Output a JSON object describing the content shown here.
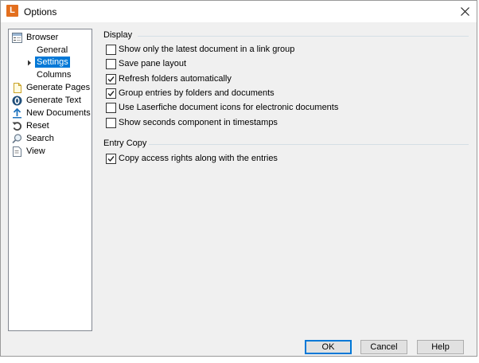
{
  "window": {
    "title": "Options",
    "app_icon_letter": "L",
    "app_icon_color": "#e36f1e"
  },
  "tree": {
    "items": [
      {
        "label": "Browser",
        "icon": "browser-icon",
        "level": 0
      },
      {
        "label": "General",
        "icon": "",
        "level": 1
      },
      {
        "label": "Settings",
        "icon": "",
        "level": 1,
        "selected": true,
        "expander": "collapsed"
      },
      {
        "label": "Columns",
        "icon": "",
        "level": 1
      },
      {
        "label": "Generate Pages",
        "icon": "generate-pages-icon",
        "level": 0
      },
      {
        "label": "Generate Text",
        "icon": "generate-text-icon",
        "level": 0
      },
      {
        "label": "New Documents",
        "icon": "new-documents-icon",
        "level": 0
      },
      {
        "label": "Reset",
        "icon": "reset-icon",
        "level": 0
      },
      {
        "label": "Search",
        "icon": "search-icon",
        "level": 0
      },
      {
        "label": "View",
        "icon": "view-icon",
        "level": 0
      }
    ],
    "selection_color": "#0078d7"
  },
  "display": {
    "title": "Display",
    "options": [
      {
        "label": "Show only the latest document in a link group",
        "checked": false
      },
      {
        "label": "Save pane layout",
        "checked": false
      },
      {
        "label": "Refresh folders automatically",
        "checked": true
      },
      {
        "label": "Group entries by folders and documents",
        "checked": true
      },
      {
        "label": "Use Laserfiche document icons for electronic documents",
        "checked": false
      },
      {
        "label": "Show seconds component in timestamps",
        "checked": false
      }
    ]
  },
  "entry_copy": {
    "title": "Entry Copy",
    "options": [
      {
        "label": "Copy access rights along with the entries",
        "checked": true
      }
    ]
  },
  "buttons": {
    "ok": "OK",
    "cancel": "Cancel",
    "help": "Help"
  }
}
